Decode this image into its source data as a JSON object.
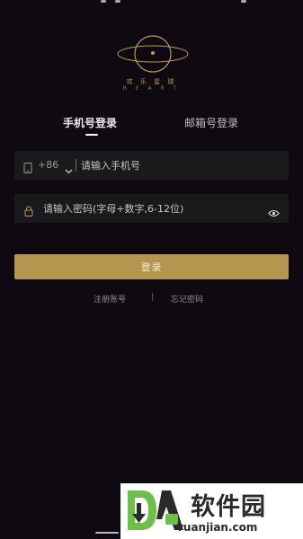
{
  "brand": {
    "logo_icon": "planet-logo-icon",
    "name_cn": "欢 乐 星 球",
    "name_en": "R E A R T"
  },
  "tabs": [
    {
      "label": "手机号登录",
      "active": true
    },
    {
      "label": "邮箱号登录",
      "active": false
    }
  ],
  "phone_field": {
    "icon": "phone-icon",
    "country_code": "+86",
    "placeholder": "请输入手机号",
    "value": ""
  },
  "password_field": {
    "icon": "lock-icon",
    "placeholder": "请输入密码(字母+数字,6-12位)",
    "value": "",
    "toggle_icon": "eye-icon"
  },
  "login_button": {
    "label": "登录"
  },
  "links": {
    "register": "注册账号",
    "divider": "|",
    "forgot": "忘记密码"
  },
  "watermark": {
    "brand_cn": "软件园",
    "brand_en": "ruanjian.com"
  },
  "colors": {
    "background": "#0f0a12",
    "accent_gold": "#b5964f",
    "input_bg": "#1a1a1c"
  }
}
